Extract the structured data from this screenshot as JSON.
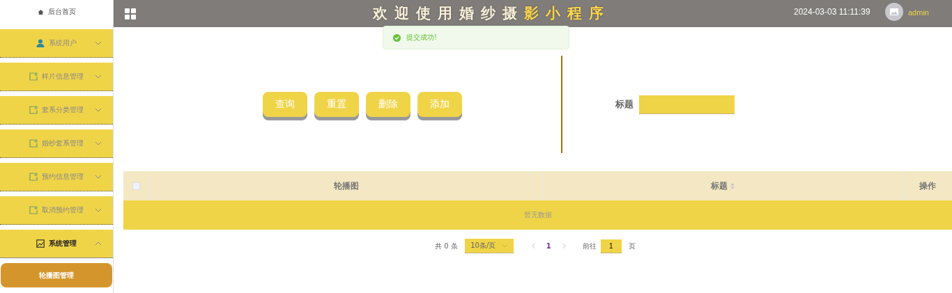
{
  "sidebar": {
    "home": "后台首页",
    "menus": [
      {
        "label": "系统用户",
        "kind": "user",
        "expanded": false
      },
      {
        "label": "样片信息管理",
        "kind": "document",
        "expanded": false
      },
      {
        "label": "套系分类管理",
        "kind": "document",
        "expanded": false
      },
      {
        "label": "婚纱套系管理",
        "kind": "document",
        "expanded": false
      },
      {
        "label": "预约信息管理",
        "kind": "document",
        "expanded": false
      },
      {
        "label": "取消预约管理",
        "kind": "document",
        "expanded": false
      },
      {
        "label": "系统管理",
        "kind": "image",
        "expanded": true,
        "children": [
          {
            "label": "轮播图管理",
            "selected": true
          }
        ]
      }
    ]
  },
  "header": {
    "title": "欢迎使用婚纱摄影小程序",
    "datetime": "2024-03-03 11:11:39",
    "user": "admin"
  },
  "toasts": [
    {
      "text": "提交成功!"
    }
  ],
  "toolbar": {
    "buttons": [
      "查询",
      "重置",
      "删除",
      "添加"
    ],
    "search_label": "标题"
  },
  "table": {
    "select_all_checked": false,
    "columns": [
      {
        "label": "轮播图",
        "sortable": false
      },
      {
        "label": "标题",
        "sortable": true
      },
      {
        "label": "操作",
        "sortable": false
      }
    ],
    "empty_text": "暂无数据"
  },
  "pagination": {
    "total": "共 0 条",
    "page_size": "10条/页",
    "pages": [
      {
        "label": "1",
        "selected": true
      }
    ],
    "goto_label": "前往",
    "goto_value": "1",
    "goto_suffix": "页"
  }
}
